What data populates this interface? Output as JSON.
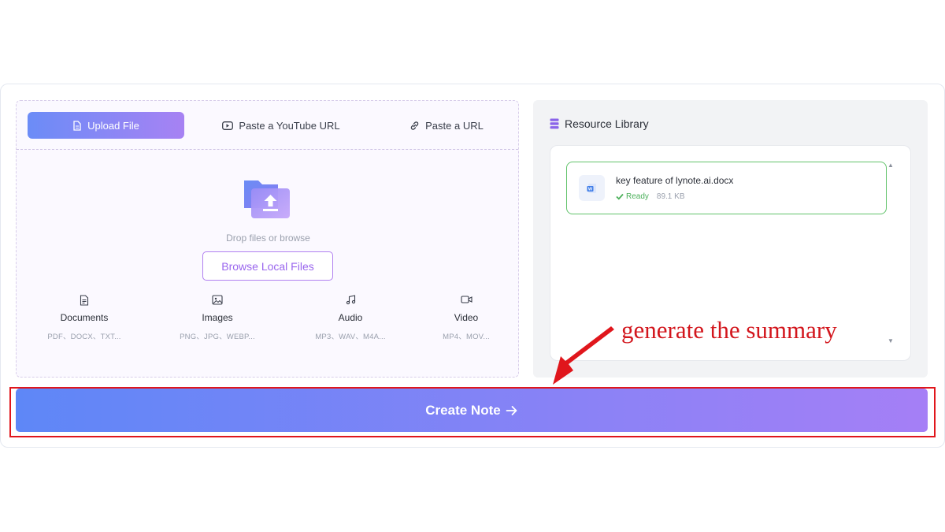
{
  "tabs": {
    "upload": "Upload File",
    "youtube": "Paste a YouTube URL",
    "url": "Paste a URL"
  },
  "dropzone": {
    "text": "Drop files or browse",
    "browse_label": "Browse Local Files"
  },
  "file_types": [
    {
      "label": "Documents",
      "formats": "PDF、DOCX、TXT...",
      "icon": "document-icon"
    },
    {
      "label": "Images",
      "formats": "PNG、JPG、WEBP...",
      "icon": "image-icon"
    },
    {
      "label": "Audio",
      "formats": "MP3、WAV、M4A...",
      "icon": "music-icon"
    },
    {
      "label": "Video",
      "formats": "MP4、MOV...",
      "icon": "video-icon"
    }
  ],
  "library": {
    "title": "Resource Library",
    "files": [
      {
        "name": "key feature of lynote.ai.docx",
        "status": "Ready",
        "size": "89.1 KB",
        "icon": "word-doc-icon"
      }
    ]
  },
  "cta": {
    "label": "Create Note"
  },
  "annotation": {
    "text": "generate the summary"
  },
  "colors": {
    "accent_start": "#5e87f7",
    "accent_end": "#a57ff6",
    "ready_green": "#4bb05a",
    "annotation_red": "#d3161d"
  }
}
